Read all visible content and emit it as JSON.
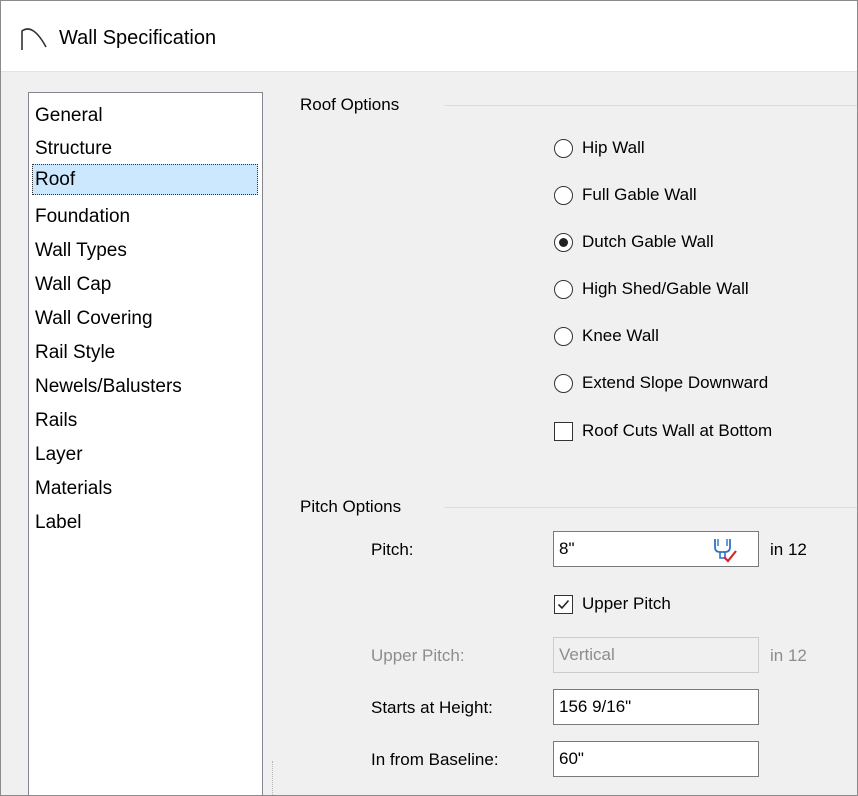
{
  "window": {
    "title": "Wall Specification",
    "title_icon": "arch-wall-icon"
  },
  "sidebar": {
    "items": [
      {
        "label": "General"
      },
      {
        "label": "Structure"
      },
      {
        "label": "Roof",
        "selected": true
      },
      {
        "label": "Foundation"
      },
      {
        "label": "Wall Types"
      },
      {
        "label": "Wall Cap"
      },
      {
        "label": "Wall Covering"
      },
      {
        "label": "Rail Style"
      },
      {
        "label": "Newels/Balusters"
      },
      {
        "label": "Rails"
      },
      {
        "label": "Layer"
      },
      {
        "label": "Materials"
      },
      {
        "label": "Label"
      }
    ]
  },
  "roof_options": {
    "group_label": "Roof Options",
    "radios": [
      {
        "label": "Hip Wall",
        "checked": false
      },
      {
        "label": "Full Gable Wall",
        "checked": false
      },
      {
        "label": "Dutch Gable Wall",
        "checked": true
      },
      {
        "label": "High Shed/Gable Wall",
        "checked": false
      },
      {
        "label": "Knee Wall",
        "checked": false
      },
      {
        "label": "Extend Slope Downward",
        "checked": false
      }
    ],
    "roof_cuts_checkbox": {
      "label": "Roof Cuts Wall at Bottom",
      "checked": false
    }
  },
  "pitch_options": {
    "group_label": "Pitch Options",
    "pitch": {
      "label": "Pitch:",
      "value": "8\"",
      "unit": "in 12",
      "icon": "pitch-calculator-icon"
    },
    "upper_pitch_checkbox": {
      "label": "Upper Pitch",
      "checked": true
    },
    "upper_pitch": {
      "label": "Upper Pitch:",
      "value": "Vertical",
      "unit": "in 12",
      "disabled": true
    },
    "starts_at_height": {
      "label": "Starts at Height:",
      "value": "156 9/16\""
    },
    "in_from_baseline": {
      "label": "In from Baseline:",
      "value": "60\""
    }
  }
}
